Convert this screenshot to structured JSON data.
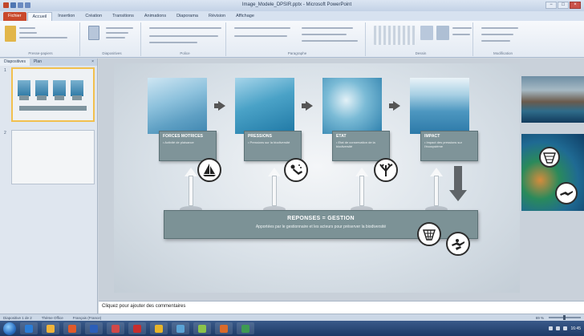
{
  "window": {
    "title": "Image_Modele_DPSIR.pptx - Microsoft PowerPoint",
    "controls": [
      "−",
      "□",
      "×"
    ]
  },
  "ribbon_tabs": [
    "Fichier",
    "Accueil",
    "Insertion",
    "Création",
    "Transitions",
    "Animations",
    "Diaporama",
    "Révision",
    "Affichage"
  ],
  "ribbon_groups": [
    "Presse-papiers",
    "Diapositives",
    "Police",
    "Paragraphe",
    "Dessin",
    "Modification"
  ],
  "left_pane": {
    "tabs": [
      "Diapositives",
      "Plan"
    ],
    "close": "×",
    "slide_numbers": [
      "1",
      "2"
    ]
  },
  "slide": {
    "cards": [
      {
        "title": "FORCES MOTRICES",
        "subtitle": "• Activité de plaisance"
      },
      {
        "title": "PRESSIONS",
        "subtitle": "• Pressions sur la biodiversité"
      },
      {
        "title": "ETAT",
        "subtitle": "• Etat de conservation de la biodiversité"
      },
      {
        "title": "IMPACT",
        "subtitle": "• Impact des pressions sur l'écosystème"
      }
    ],
    "response": {
      "title": "REPONSES = GESTION",
      "subtitle": "Apportées par le gestionnaire et les acteurs pour préserver la biodiversité"
    },
    "icons": [
      "sailboat-icon",
      "diver-icon",
      "coral-icon",
      "fishing-net-icon",
      "divers-group-icon"
    ]
  },
  "notes": {
    "placeholder": "Cliquez pour ajouter des commentaires"
  },
  "status_bar": {
    "left": [
      "Diapositive 1 de 2",
      "Thème Office",
      "Français (France)"
    ],
    "zoom": "69 %"
  },
  "taskbar": {
    "apps": [
      "ie",
      "folder",
      "media",
      "word",
      "excel-red",
      "acrobat",
      "chrome",
      "paint",
      "photos",
      "powerpoint",
      "project"
    ],
    "colors": [
      "#2a7cd6",
      "#f0b43a",
      "#e05a2a",
      "#2b5eb8",
      "#d04848",
      "#c82d2d",
      "#e8b52a",
      "#5aa3d6",
      "#8bc34a",
      "#d96a2a",
      "#3e9a52"
    ],
    "time": "16:45"
  }
}
